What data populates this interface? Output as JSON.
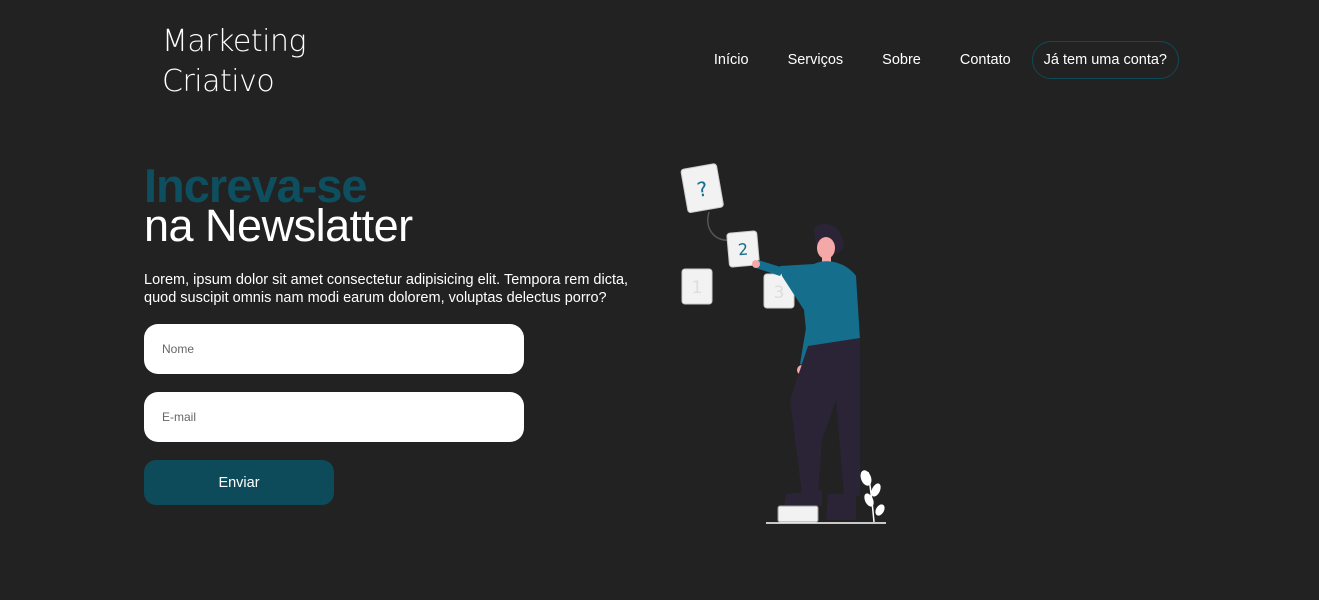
{
  "logo": {
    "line1": "Marketing",
    "line2": "Criativo"
  },
  "nav": {
    "items": [
      "Início",
      "Serviços",
      "Sobre",
      "Contato"
    ],
    "login_label": "Já tem uma conta?"
  },
  "hero": {
    "headline_accent": "Increva-se",
    "headline_main": "na Newslatter",
    "lead": "Lorem, ipsum dolor sit amet consectetur adipisicing elit. Tempora rem dicta, quod suscipit omnis nam modi earum dolorem, voluptas delectus porro?"
  },
  "form": {
    "name_placeholder": "Nome",
    "email_placeholder": "E-mail",
    "submit_label": "Enviar"
  },
  "illustration": {
    "cards": [
      "?",
      "2",
      "1",
      "3"
    ]
  },
  "colors": {
    "background": "#222222",
    "accent": "#0d4f5e",
    "button": "#0d4a5a",
    "shirt": "#146e8c"
  }
}
